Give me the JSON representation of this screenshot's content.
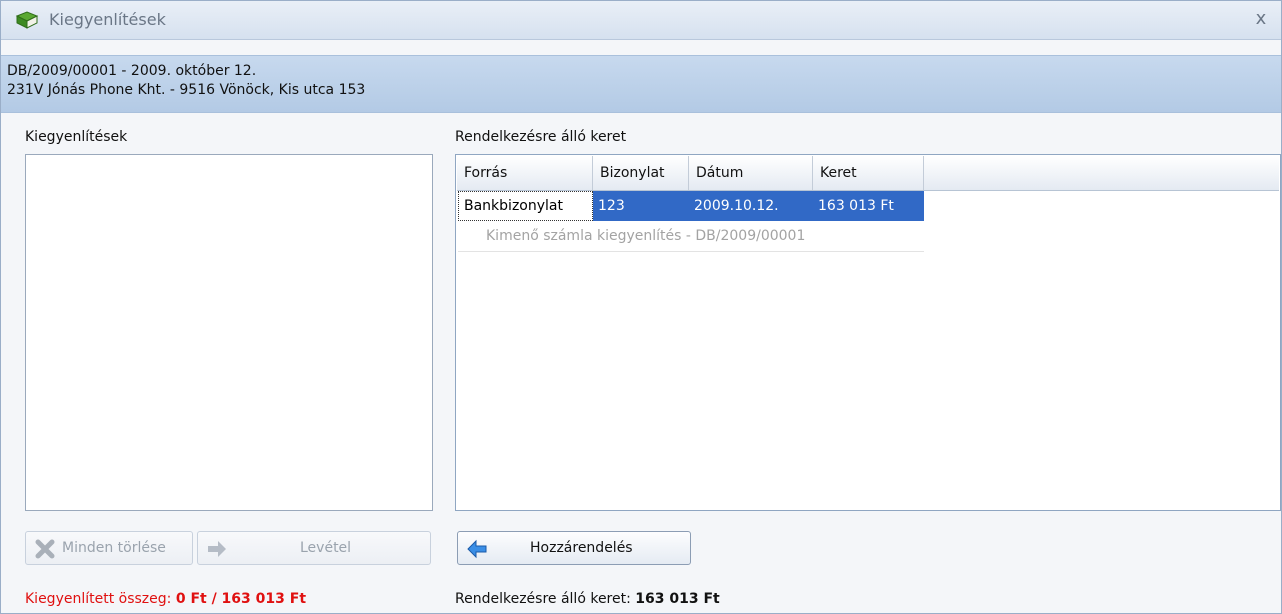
{
  "window": {
    "title": "Kiegyenlítések",
    "close_glyph": "x"
  },
  "info": {
    "line1": "DB/2009/00001 - 2009. október 12.",
    "line2": "231V Jónás Phone Kht. - 9516 Vönöck, Kis utca 153"
  },
  "left_panel": {
    "label": "Kiegyenlítések"
  },
  "right_panel": {
    "label": "Rendelkezésre álló keret",
    "columns": [
      "Forrás",
      "Bizonylat",
      "Dátum",
      "Keret"
    ],
    "rows": [
      {
        "forras": "Bankbizonylat",
        "bizonylat": "123",
        "datum": "2009.10.12.",
        "keret": "163 013 Ft"
      }
    ],
    "detail": "Kimenő számla kiegyenlítés - DB/2009/00001"
  },
  "buttons": {
    "clear_all": "Minden törlése",
    "remove": "Levétel",
    "assign": "Hozzárendelés"
  },
  "footer": {
    "settled_label": "Kiegyenlített összeg: ",
    "settled_value": "0 Ft / 163 013 Ft",
    "available_label": "Rendelkezésre álló keret: ",
    "available_value": "163 013 Ft"
  },
  "colors": {
    "selection": "#3169c6",
    "warning_text": "#e01010",
    "infobar": "#c0d4eb"
  },
  "icons": [
    "book-icon",
    "close-icon",
    "delete-x-icon",
    "arrow-right-icon",
    "arrow-left-icon"
  ]
}
